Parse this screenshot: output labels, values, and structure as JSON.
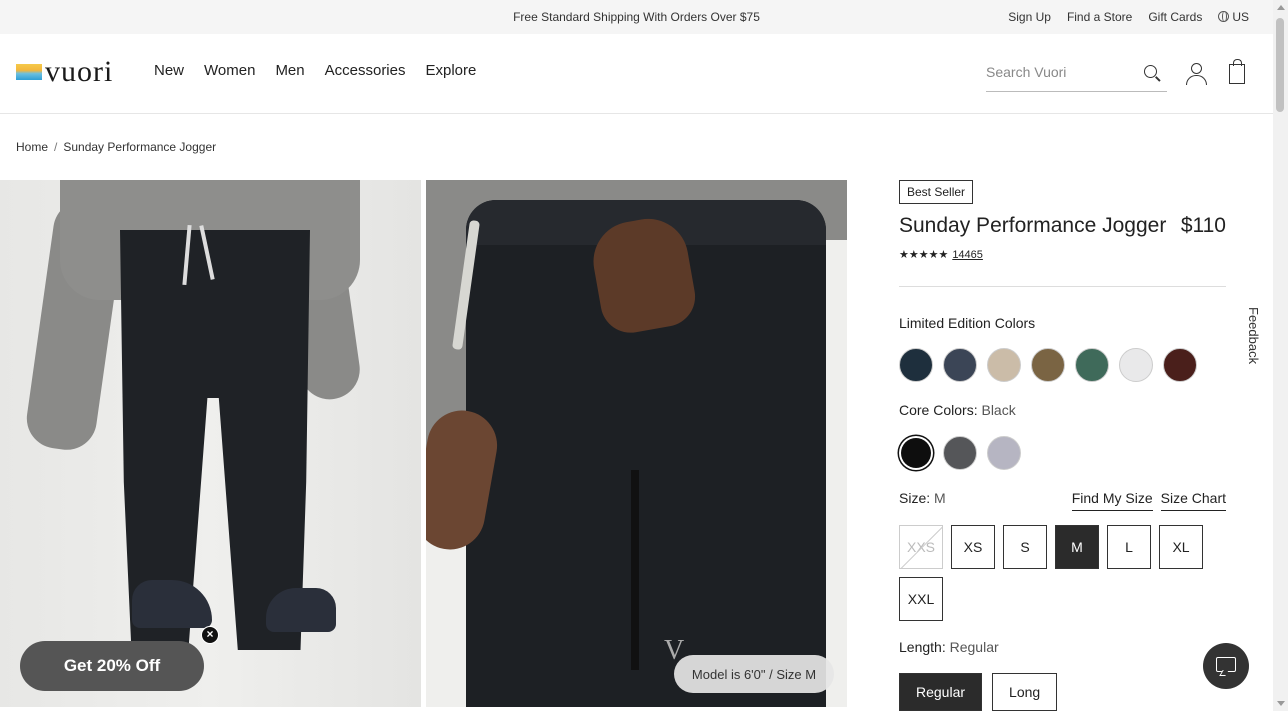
{
  "promo_bar": {
    "message": "Free Standard Shipping With Orders Over $75",
    "links": [
      "Sign Up",
      "Find a Store",
      "Gift Cards"
    ],
    "region": "US"
  },
  "header": {
    "logo_text": "vuori",
    "nav": [
      "New",
      "Women",
      "Men",
      "Accessories",
      "Explore"
    ],
    "search_placeholder": "Search Vuori"
  },
  "breadcrumb": [
    "Home",
    "Sunday Performance Jogger"
  ],
  "product": {
    "badge": "Best Seller",
    "title": "Sunday Performance Jogger",
    "price": "$110",
    "stars": "★★★★★",
    "rating_value": 5,
    "review_count": "14465",
    "limited_label": "Limited Edition Colors",
    "limited_colors": [
      "#1e2f3d",
      "#3b4556",
      "#cbbca8",
      "#7a6443",
      "#3f6a5a",
      "#e9e9ea",
      "#4a1f1b"
    ],
    "core_label": "Core Colors:",
    "core_value": "Black",
    "core_colors": [
      "#0e0e0e",
      "#555659",
      "#b6b5c2"
    ],
    "size_label": "Size:",
    "size_value": "M",
    "find_size": "Find My Size",
    "size_chart": "Size Chart",
    "sizes": [
      "XXS",
      "XS",
      "S",
      "M",
      "L",
      "XL",
      "XXL"
    ],
    "length_label": "Length:",
    "length_value": "Regular",
    "lengths": [
      "Regular",
      "Long"
    ]
  },
  "model_info": "Model is 6'0\" / Size M",
  "promo_pill": "Get 20% Off",
  "feedback": "Feedback"
}
